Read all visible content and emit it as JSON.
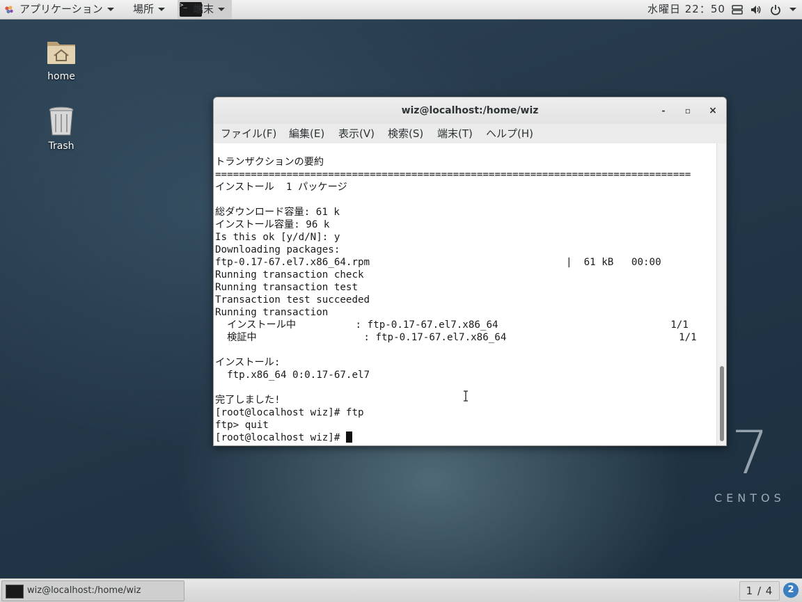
{
  "topbar": {
    "apps_label": "アプリケーション",
    "places_label": "場所",
    "terminal_label": "端末",
    "terminal_icon_text": ">_",
    "clock": "水曜日 22：50"
  },
  "desktop": {
    "icons": [
      {
        "label": "home",
        "icon": "home-folder-icon"
      },
      {
        "label": "Trash",
        "icon": "trash-icon"
      }
    ]
  },
  "window": {
    "title": "wiz@localhost:/home/wiz",
    "minimize": "‐",
    "maximize": "▫",
    "close": "×",
    "menu": [
      "ファイル(F)",
      "編集(E)",
      "表示(V)",
      "検索(S)",
      "端末(T)",
      "ヘルプ(H)"
    ]
  },
  "terminal": {
    "lines": [
      "トランザクションの要約",
      "================================================================================",
      "インストール  1 パッケージ",
      "",
      "総ダウンロード容量: 61 k",
      "インストール容量: 96 k",
      "Is this ok [y/d/N]: y",
      "Downloading packages:",
      "ftp-0.17-67.el7.x86_64.rpm                                 |  61 kB   00:00",
      "Running transaction check",
      "Running transaction test",
      "Transaction test succeeded",
      "Running transaction",
      "  インストール中          : ftp-0.17-67.el7.x86_64                             1/1",
      "  検証中                  : ftp-0.17-67.el7.x86_64                             1/1",
      "",
      "インストール:",
      "  ftp.x86_64 0:0.17-67.el7",
      "",
      "完了しました!",
      "[root@localhost wiz]# ftp",
      "ftp> quit"
    ],
    "prompt": "[root@localhost wiz]# "
  },
  "branding": {
    "number": "7",
    "word": "CENTOS"
  },
  "taskbar": {
    "task_label": "wiz@localhost:/home/wiz",
    "workspace": "1 / 4",
    "notifications": "2"
  },
  "colors": {
    "accent": "#3d7ec0",
    "terminal_bg": "#ffffff",
    "terminal_fg": "#1a1a1a"
  }
}
